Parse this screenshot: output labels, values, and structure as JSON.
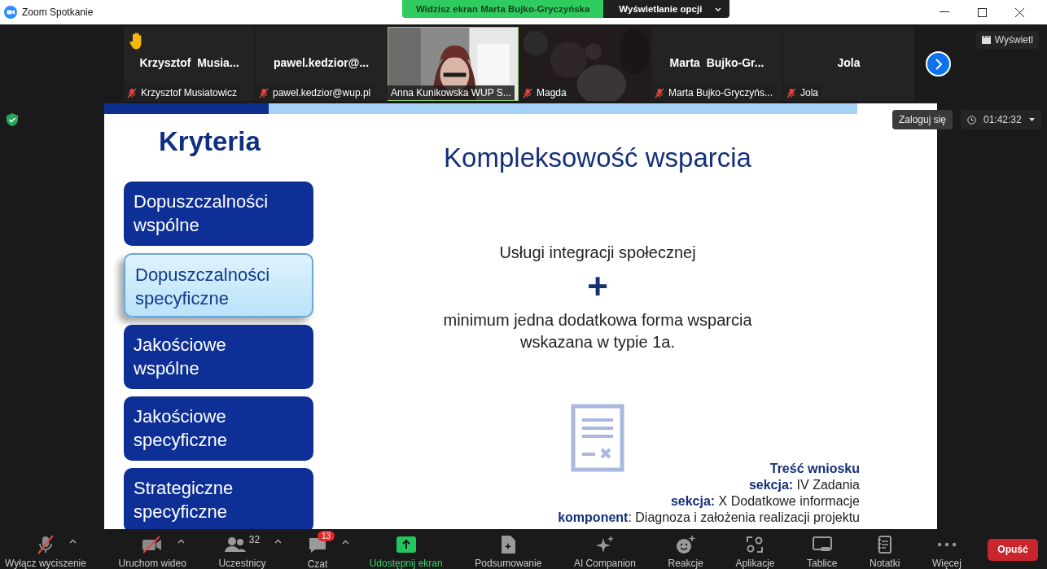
{
  "window": {
    "title": "Zoom Spotkanie"
  },
  "share_banner": {
    "text": "Widzisz ekran Marta Bujko-Gryczyńska",
    "options_button": "Wyświetlanie opcji"
  },
  "participants": [
    {
      "kind": "name",
      "display_name": "Krzysztof  Musia...",
      "label": "Krzysztof Musiatowicz",
      "muted": true,
      "hand_raised": true,
      "speaking": false
    },
    {
      "kind": "name",
      "display_name": "pawel.kedzior@...",
      "label": "pawel.kedzior@wup.pl",
      "muted": true,
      "hand_raised": false,
      "speaking": false
    },
    {
      "kind": "video",
      "label": "Anna Kunikowska WUP S...",
      "muted": false,
      "hand_raised": false,
      "speaking": true
    },
    {
      "kind": "video",
      "label": "Magda",
      "muted": true,
      "hand_raised": false,
      "speaking": false
    },
    {
      "kind": "name",
      "display_name": "Marta  Bujko-Gr...",
      "label": "Marta Bujko-Gryczyńs...",
      "muted": true,
      "hand_raised": false,
      "speaking": false
    },
    {
      "kind": "name",
      "display_name": "Jola",
      "label": "Jola",
      "muted": true,
      "hand_raised": false,
      "speaking": false
    }
  ],
  "view_button": "Wyświetl",
  "login_tooltip": "Zaloguj się",
  "timer": "01:42:32",
  "slide": {
    "heading": "Kryteria",
    "nav": [
      {
        "label": "Dopuszczalności wspólne",
        "selected": false
      },
      {
        "label": "Dopuszczalności specyficzne",
        "selected": true
      },
      {
        "label": "Jakościowe wspólne",
        "selected": false
      },
      {
        "label": "Jakościowe specyficzne",
        "selected": false
      },
      {
        "label": "Strategiczne specyficzne",
        "selected": false
      }
    ],
    "title": "Kompleksowość wsparcia",
    "line_1": "Usługi integracji społecznej",
    "plus": "+",
    "line_2": "minimum jedna dodatkowa forma wsparcia wskazana w typie 1a.",
    "source_heading": "Treść wniosku",
    "source_lines": [
      "**sekcja:**  IV Zadania",
      "**sekcja:** X Dodatkowe informacje",
      "**komponent**: Diagnoza i założenia realizacji projektu"
    ]
  },
  "toolbar": [
    {
      "kind": "mic",
      "label": "Wyłącz wyciszenie",
      "off": true,
      "caret": true
    },
    {
      "kind": "video",
      "label": "Uruchom wideo",
      "off": true,
      "caret": true
    },
    {
      "kind": "people",
      "label": "Uczestnicy",
      "count": "32",
      "caret": true
    },
    {
      "kind": "chat",
      "label": "Czat",
      "badge": "13",
      "caret": true
    },
    {
      "kind": "share",
      "label": "Udostępnij ekran",
      "caret": false
    },
    {
      "kind": "summary",
      "label": "Podsumowanie",
      "caret": false
    },
    {
      "kind": "ai",
      "label": "AI Companion",
      "caret": false
    },
    {
      "kind": "reaction",
      "label": "Reakcje",
      "caret": false
    },
    {
      "kind": "apps",
      "label": "Aplikacje",
      "caret": false
    },
    {
      "kind": "board",
      "label": "Tablice",
      "caret": false
    },
    {
      "kind": "notes",
      "label": "Notatki",
      "caret": false
    },
    {
      "kind": "more",
      "label": "Więcej",
      "caret": false
    }
  ],
  "leave_button": "Opuść"
}
